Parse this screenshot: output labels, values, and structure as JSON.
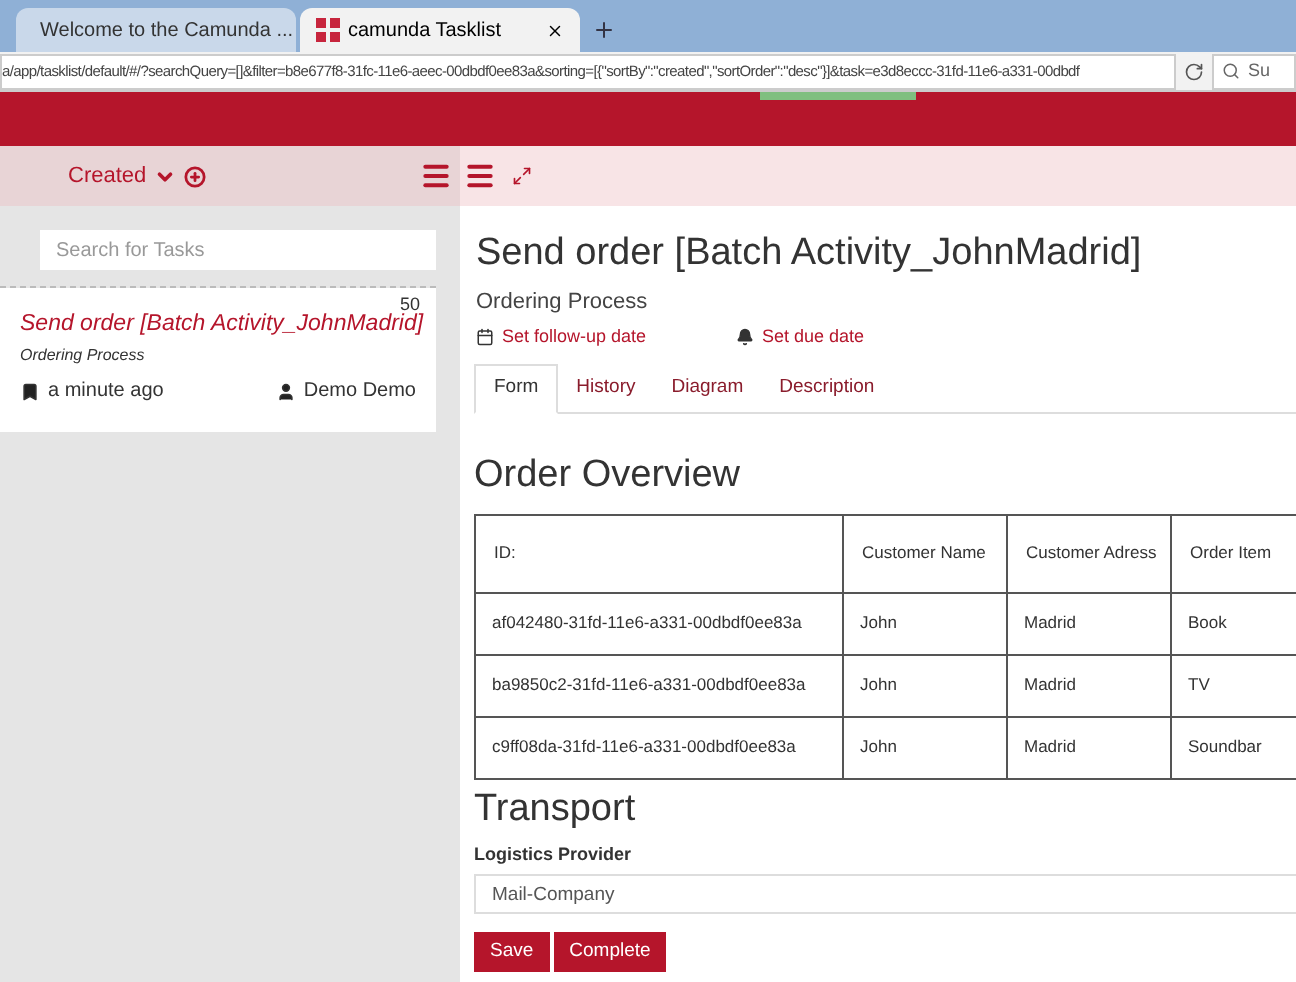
{
  "browser": {
    "tabs": [
      {
        "label": "Welcome to the Camunda ...",
        "selected": false
      },
      {
        "label": "camunda Tasklist",
        "selected": true
      }
    ],
    "address": "a/app/tasklist/default/#/?searchQuery=[]&filter=b8e677f8-31fc-11e6-aeec-00dbdf0ee83a&sorting=[{\"sortBy\":\"created\",\"sortOrder\":\"desc\"}]&task=e3d8eccc-31fd-11e6-a331-00dbdf",
    "search_placeholder": "Su"
  },
  "sidebar": {
    "sort_label": "Created",
    "search": {
      "placeholder": "Search for Tasks"
    },
    "tasks": [
      {
        "title": "Send order [Batch Activity_JohnMadrid]",
        "priority": "50",
        "process": "Ordering Process",
        "created": "a minute ago",
        "assignee": "Demo Demo",
        "selected": true
      }
    ]
  },
  "task": {
    "title": "Send order [Batch Activity_JohnMadrid]",
    "process": "Ordering Process",
    "follow_up": "Set follow-up date",
    "due": "Set due date",
    "tabs": [
      {
        "label": "Form",
        "selected": true
      },
      {
        "label": "History",
        "selected": false
      },
      {
        "label": "Diagram",
        "selected": false
      },
      {
        "label": "Description",
        "selected": false
      }
    ]
  },
  "form": {
    "heading": "Order Overview",
    "table": {
      "columns": [
        "ID:",
        "Customer Name",
        "Customer Adress",
        "Order Item"
      ],
      "rows": [
        [
          "af042480-31fd-11e6-a331-00dbdf0ee83a",
          "John",
          "Madrid",
          "Book"
        ],
        [
          "ba9850c2-31fd-11e6-a331-00dbdf0ee83a",
          "John",
          "Madrid",
          "TV"
        ],
        [
          "c9ff08da-31fd-11e6-a331-00dbdf0ee83a",
          "John",
          "Madrid",
          "Soundbar"
        ]
      ]
    },
    "section": "Transport",
    "field_label": "Logistics Provider",
    "field_value": "Mail-Company",
    "buttons": [
      "Save",
      "Complete"
    ]
  }
}
